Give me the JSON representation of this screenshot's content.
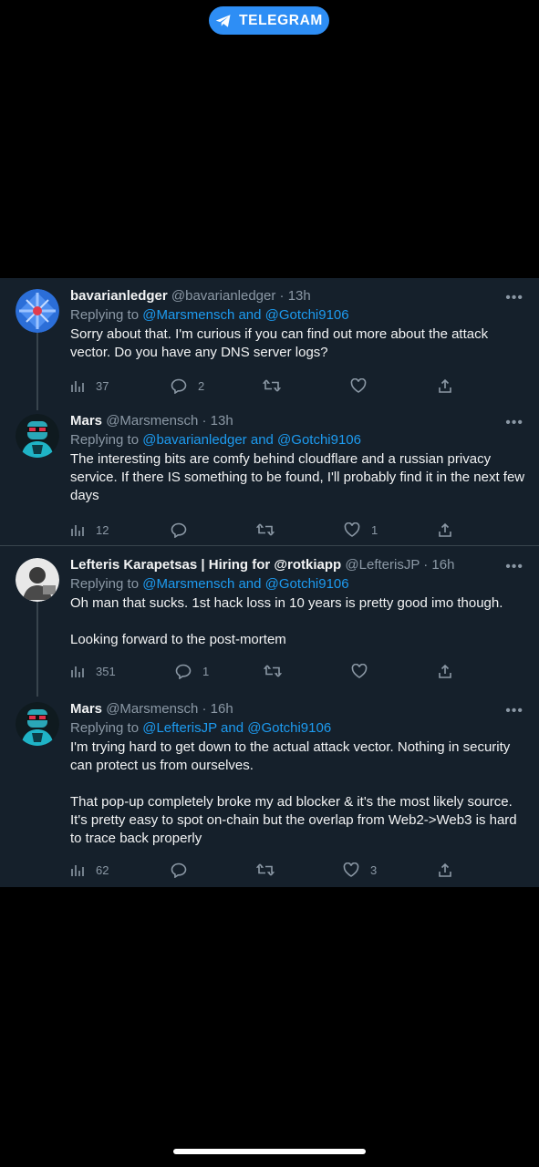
{
  "header": {
    "telegram_label": "TELEGRAM"
  },
  "tweets": [
    {
      "name": "bavarianledger",
      "handle": "@bavarianledger",
      "time": "· 13h",
      "replying_prefix": "Replying to",
      "replying_to": "@Marsmensch and @Gotchi9106",
      "text": [
        "Sorry about that. I'm curious if you can find out more about the attack vector. Do you have any DNS server logs?"
      ],
      "views": "37",
      "replies": "2",
      "retweets": "",
      "likes": ""
    },
    {
      "name": "Mars",
      "handle": "@Marsmensch",
      "time": "· 13h",
      "replying_prefix": "Replying to",
      "replying_to": "@bavarianledger and @Gotchi9106",
      "text": [
        "The interesting bits are comfy behind cloudflare and a russian privacy service. If there IS something to be found, I'll probably find it in the next few days"
      ],
      "views": "12",
      "replies": "",
      "retweets": "",
      "likes": "1"
    },
    {
      "name": "Lefteris Karapetsas | Hiring for @rotkiapp",
      "handle": "@LefterisJP",
      "time": "· 16h",
      "replying_prefix": "Replying to",
      "replying_to": "@Marsmensch and @Gotchi9106",
      "text": [
        "Oh man that sucks. 1st hack loss in 10 years is pretty good imo though.",
        "Looking forward to the post-mortem"
      ],
      "views": "351",
      "replies": "1",
      "retweets": "",
      "likes": ""
    },
    {
      "name": "Mars",
      "handle": "@Marsmensch",
      "time": "· 16h",
      "replying_prefix": "Replying to",
      "replying_to": "@LefterisJP and @Gotchi9106",
      "text": [
        "I'm trying hard to get down to the actual attack vector. Nothing in security can protect us from ourselves.",
        "That pop-up completely broke my ad blocker & it's the most likely source. It's pretty easy to spot on-chain but the overlap from Web2->Web3 is hard to trace back properly"
      ],
      "views": "62",
      "replies": "",
      "retweets": "",
      "likes": "3"
    }
  ],
  "colors": {
    "panel_bg": "#15202b",
    "mention": "#1d9bf0",
    "muted": "#8b98a5",
    "telegram": "#2e8ef5"
  }
}
